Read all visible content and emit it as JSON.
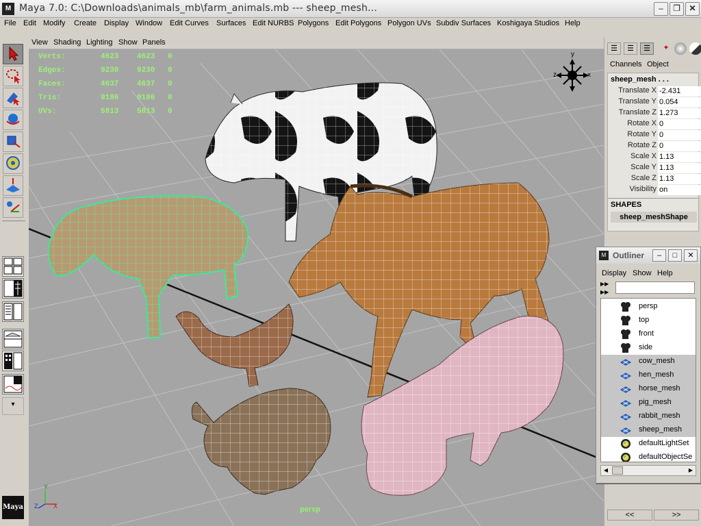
{
  "window": {
    "title": "Maya 7.0: C:\\Downloads\\animals_mb\\farm_animals.mb  ---  sheep_mesh...",
    "logo": "M",
    "controls": [
      "minimize-icon",
      "restore-icon",
      "close-icon"
    ]
  },
  "menubar": {
    "items": [
      "File",
      "Edit",
      "Modify",
      "Create",
      "Display",
      "Window",
      "Edit Curves",
      "Surfaces",
      "Edit NURBS",
      "Polygons",
      "Edit Polygons",
      "Polygon UVs",
      "Subdiv Surfaces",
      "Koshigaya Studios",
      "Help"
    ]
  },
  "toolbox": {
    "tools": [
      "select-arrow-icon",
      "lasso-icon",
      "paint-select-icon",
      "rotate-tool-icon",
      "scale-tool-icon",
      "universal-manipulator-icon",
      "soft-mod-icon",
      "show-manipulator-icon"
    ]
  },
  "viewport": {
    "menu": [
      "View",
      "Shading",
      "Lighting",
      "Show",
      "Panels"
    ],
    "hud": [
      {
        "label": "Verts:",
        "a": "4623",
        "b": "4623",
        "c": "0"
      },
      {
        "label": "Edges:",
        "a": "9230",
        "b": "9230",
        "c": "0"
      },
      {
        "label": "Faces:",
        "a": "4637",
        "b": "4637",
        "c": "0"
      },
      {
        "label": "Tris:",
        "a": "9186",
        "b": "9186",
        "c": "0"
      },
      {
        "label": "UVs:",
        "a": "5813",
        "b": "5813",
        "c": "0"
      }
    ],
    "camera_label": "persp",
    "view_cube": {
      "y": "y",
      "z": "z",
      "x": "x"
    },
    "axis": {
      "y": "Y",
      "z": "Z",
      "x": "X"
    },
    "brand_logo": "Maya"
  },
  "channel_box": {
    "tabs": [
      "Channels",
      "Object"
    ],
    "object_name": "sheep_mesh . . .",
    "attributes": [
      {
        "label": "Translate X",
        "value": "-2.431"
      },
      {
        "label": "Translate Y",
        "value": "0.054"
      },
      {
        "label": "Translate Z",
        "value": "1.273"
      },
      {
        "label": "Rotate X",
        "value": "0"
      },
      {
        "label": "Rotate Y",
        "value": "0"
      },
      {
        "label": "Rotate Z",
        "value": "0"
      },
      {
        "label": "Scale X",
        "value": "1.13"
      },
      {
        "label": "Scale Y",
        "value": "1.13"
      },
      {
        "label": "Scale Z",
        "value": "1.13"
      },
      {
        "label": "Visibility",
        "value": "on"
      }
    ],
    "shapes_header": "SHAPES",
    "shape_name": "sheep_meshShape",
    "scroll_left": "<<",
    "scroll_right": ">>"
  },
  "outliner": {
    "title": "Outliner",
    "menu": [
      "Display",
      "Show",
      "Help"
    ],
    "items": [
      {
        "label": "persp",
        "icon": "camera-icon",
        "selected": false
      },
      {
        "label": "top",
        "icon": "camera-icon",
        "selected": false
      },
      {
        "label": "front",
        "icon": "camera-icon",
        "selected": false
      },
      {
        "label": "side",
        "icon": "camera-icon",
        "selected": false
      },
      {
        "label": "cow_mesh",
        "icon": "mesh-icon",
        "selected": true
      },
      {
        "label": "hen_mesh",
        "icon": "mesh-icon",
        "selected": true
      },
      {
        "label": "horse_mesh",
        "icon": "mesh-icon",
        "selected": true
      },
      {
        "label": "pig_mesh",
        "icon": "mesh-icon",
        "selected": true
      },
      {
        "label": "rabbit_mesh",
        "icon": "mesh-icon",
        "selected": true
      },
      {
        "label": "sheep_mesh",
        "icon": "mesh-icon",
        "selected": true
      },
      {
        "label": "defaultLightSet",
        "icon": "set-icon",
        "selected": false
      },
      {
        "label": "defaultObjectSe",
        "icon": "set-icon",
        "selected": false
      }
    ]
  },
  "colors": {
    "hud": "#9ef078",
    "selection": "#7cf0a0",
    "viewport_bg": "#a5a5a5",
    "ui_gray": "#d4d0c8"
  }
}
